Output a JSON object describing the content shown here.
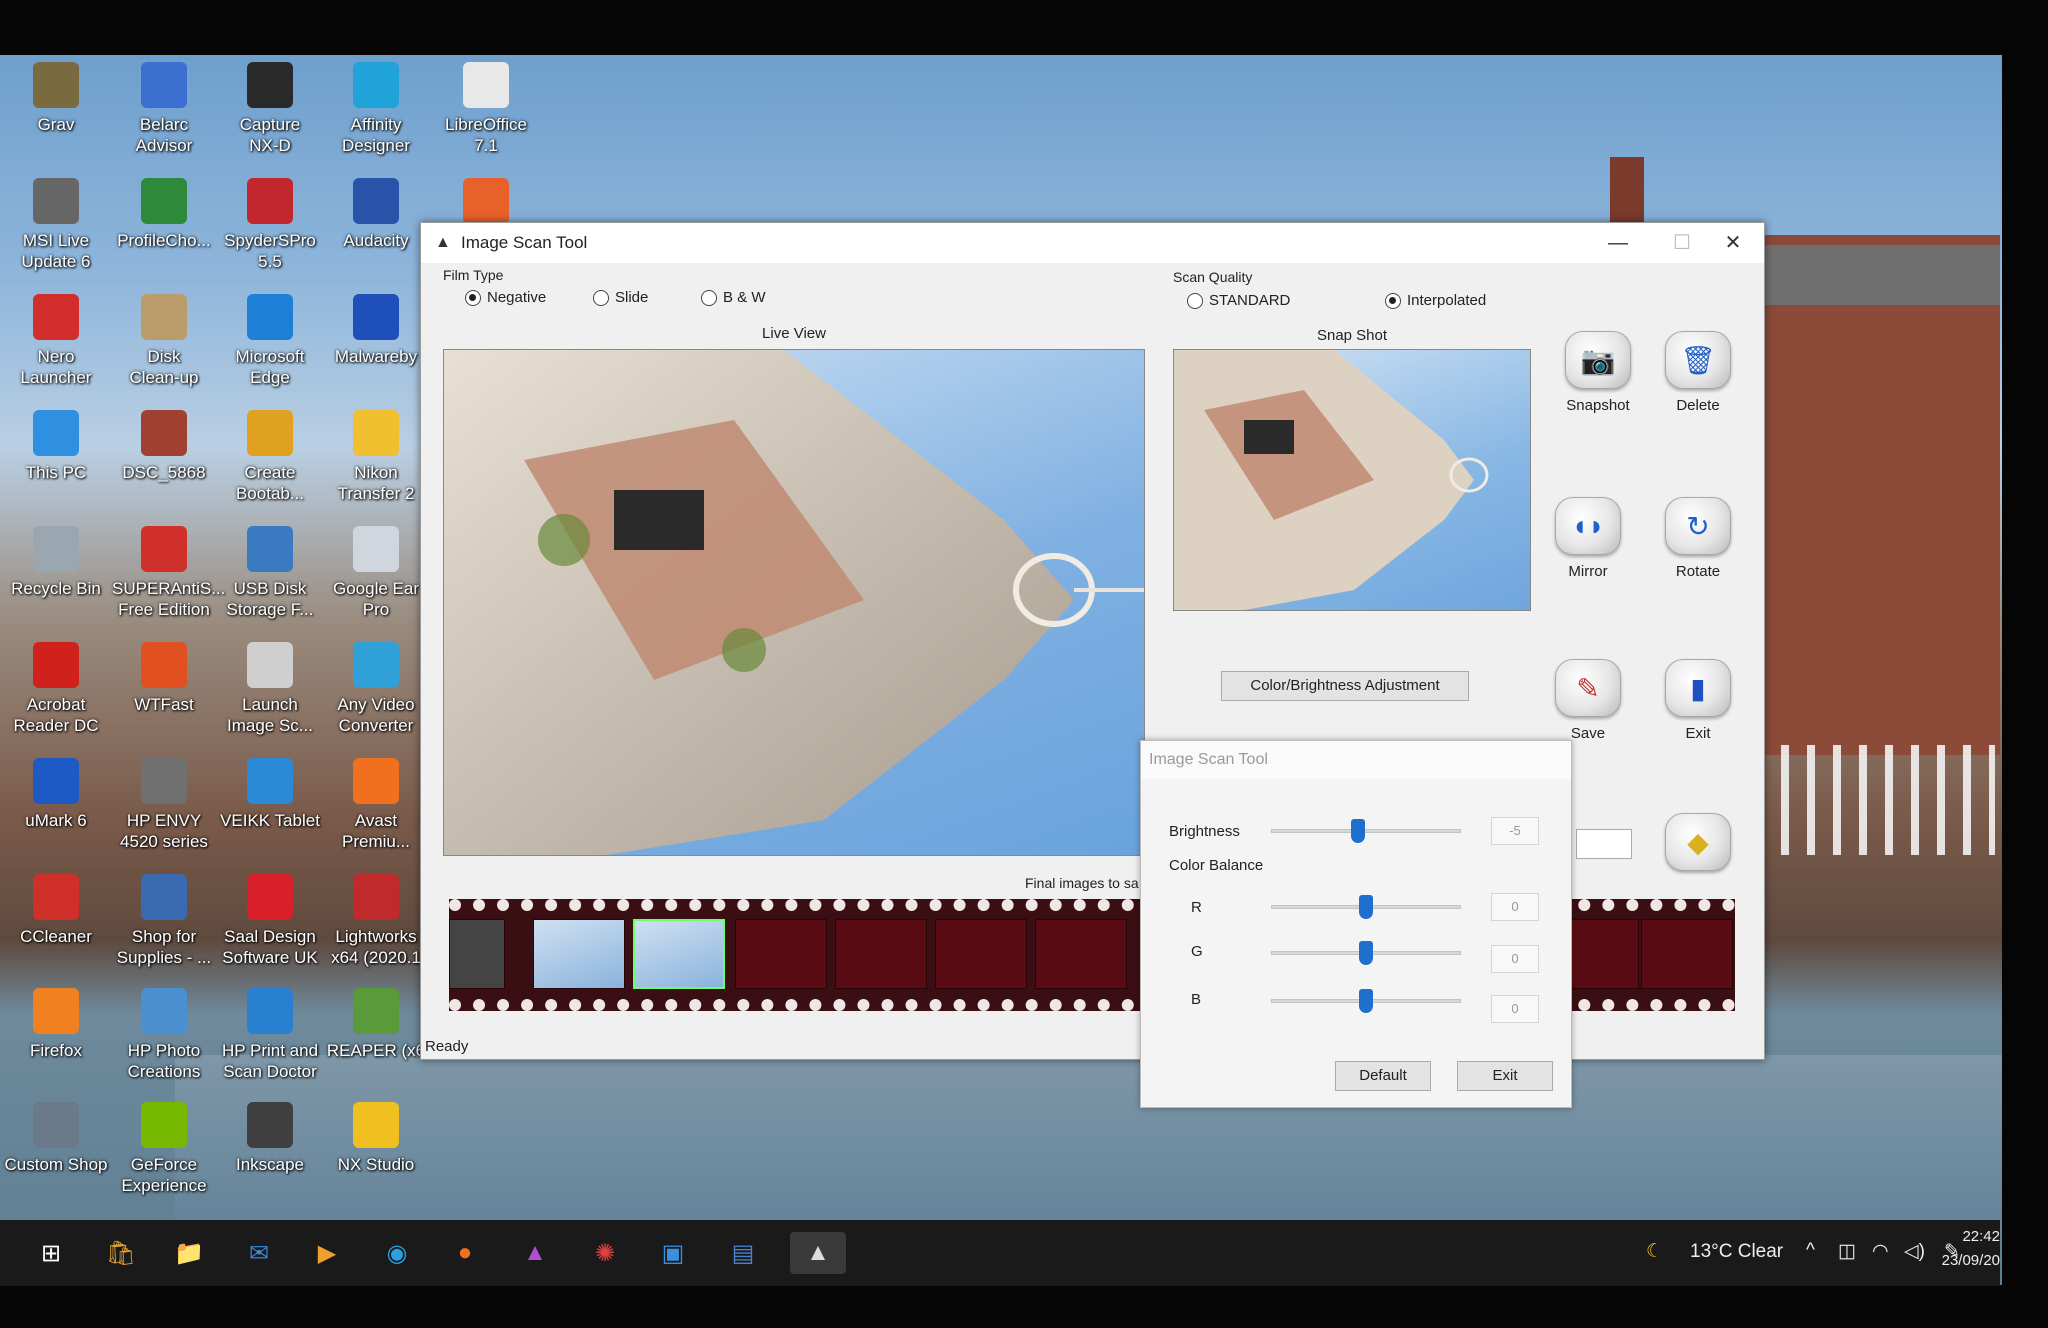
{
  "desktop_icons": [
    {
      "label": "Grav",
      "color": "#7a6a40"
    },
    {
      "label": "Belarc\nAdvisor",
      "color": "#3b6fd0"
    },
    {
      "label": "Capture\nNX-D",
      "color": "#2a2a2a"
    },
    {
      "label": "Affinity\nDesigner",
      "color": "#1fa3d9"
    },
    {
      "label": "LibreOffice\n7.1",
      "color": "#e8e8e8"
    },
    {
      "label": "MSI Live\nUpdate 6",
      "color": "#666666"
    },
    {
      "label": "ProfileCho...",
      "color": "#2c8a3a"
    },
    {
      "label": "SpyderSPro\n5.5",
      "color": "#c2272d"
    },
    {
      "label": "Audacity",
      "color": "#2853a8"
    },
    {
      "label": "",
      "color": "#e8602a"
    },
    {
      "label": "Nero\nLauncher",
      "color": "#d22e2e"
    },
    {
      "label": "Disk\nClean-up",
      "color": "#b99c6a"
    },
    {
      "label": "Microsoft\nEdge",
      "color": "#1e7fd6"
    },
    {
      "label": "Malwareby",
      "color": "#1f4fb8"
    },
    {
      "label": "This PC",
      "color": "#2f8fe0"
    },
    {
      "label": "DSC_5868",
      "color": "#a04030"
    },
    {
      "label": "Create\nBootab...",
      "color": "#e0a020"
    },
    {
      "label": "Nikon\nTransfer 2",
      "color": "#f0c030"
    },
    {
      "label": "Recycle Bin",
      "color": "#9aa6b0"
    },
    {
      "label": "SUPERAntiS...\nFree Edition",
      "color": "#d0302a"
    },
    {
      "label": "USB Disk\nStorage F...",
      "color": "#3a7ac0"
    },
    {
      "label": "Google Ear\nPro",
      "color": "#cfd6dd"
    },
    {
      "label": "Acrobat\nReader DC",
      "color": "#d0211c"
    },
    {
      "label": "WTFast",
      "color": "#e05020"
    },
    {
      "label": "Launch\nImage Sc...",
      "color": "#cfcfcf"
    },
    {
      "label": "Any Video\nConverter",
      "color": "#2fa0d8"
    },
    {
      "label": "uMark 6",
      "color": "#1d5ac4"
    },
    {
      "label": "HP ENVY\n4520 series",
      "color": "#707070"
    },
    {
      "label": "VEIKK Tablet",
      "color": "#2a8ad8"
    },
    {
      "label": "Avast\nPremiu...",
      "color": "#f07020"
    },
    {
      "label": "CCleaner",
      "color": "#d0302a"
    },
    {
      "label": "Shop for\nSupplies - ...",
      "color": "#3a6ab0"
    },
    {
      "label": "Saal Design\nSoftware UK",
      "color": "#d8202a"
    },
    {
      "label": "Lightworks\nx64 (2020.1",
      "color": "#c02a2a"
    },
    {
      "label": "Firefox",
      "color": "#f08020"
    },
    {
      "label": "HP Photo\nCreations",
      "color": "#4a90d0"
    },
    {
      "label": "HP Print and\nScan Doctor",
      "color": "#2a80d0"
    },
    {
      "label": "REAPER (x6",
      "color": "#5a9a3a"
    },
    {
      "label": "Custom Shop",
      "color": "#6a7a8a"
    },
    {
      "label": "GeForce\nExperience",
      "color": "#76b900"
    },
    {
      "label": "Inkscape",
      "color": "#404040"
    },
    {
      "label": "NX Studio",
      "color": "#f0c020"
    }
  ],
  "window": {
    "title": "Image Scan Tool",
    "minimize": "—",
    "maximize": "☐",
    "close": "✕",
    "film_type": {
      "label": "Film Type",
      "options": [
        "Negative",
        "Slide",
        "B & W"
      ],
      "selected": "Negative"
    },
    "scan_quality": {
      "label": "Scan Quality",
      "options": [
        "STANDARD",
        "Interpolated"
      ],
      "selected": "Interpolated"
    },
    "live_view_label": "Live View",
    "snap_shot_label": "Snap Shot",
    "buttons": {
      "snapshot": "Snapshot",
      "delete": "Delete",
      "mirror": "Mirror",
      "rotate": "Rotate",
      "save": "Save",
      "exit": "Exit"
    },
    "color_adjust_button": "Color/Brightness Adjustment",
    "final_images_label": "Final images to sa",
    "status": "Ready"
  },
  "dialog": {
    "title": "Image Scan Tool",
    "brightness_label": "Brightness",
    "brightness_value": "-5",
    "color_balance_label": "Color Balance",
    "r_label": "R",
    "g_label": "G",
    "b_label": "B",
    "r_value": "0",
    "g_value": "0",
    "b_value": "0",
    "default_button": "Default",
    "exit_button": "Exit"
  },
  "taskbar": {
    "weather": "13°C  Clear",
    "time": "22:42",
    "date": "23/09/20"
  }
}
